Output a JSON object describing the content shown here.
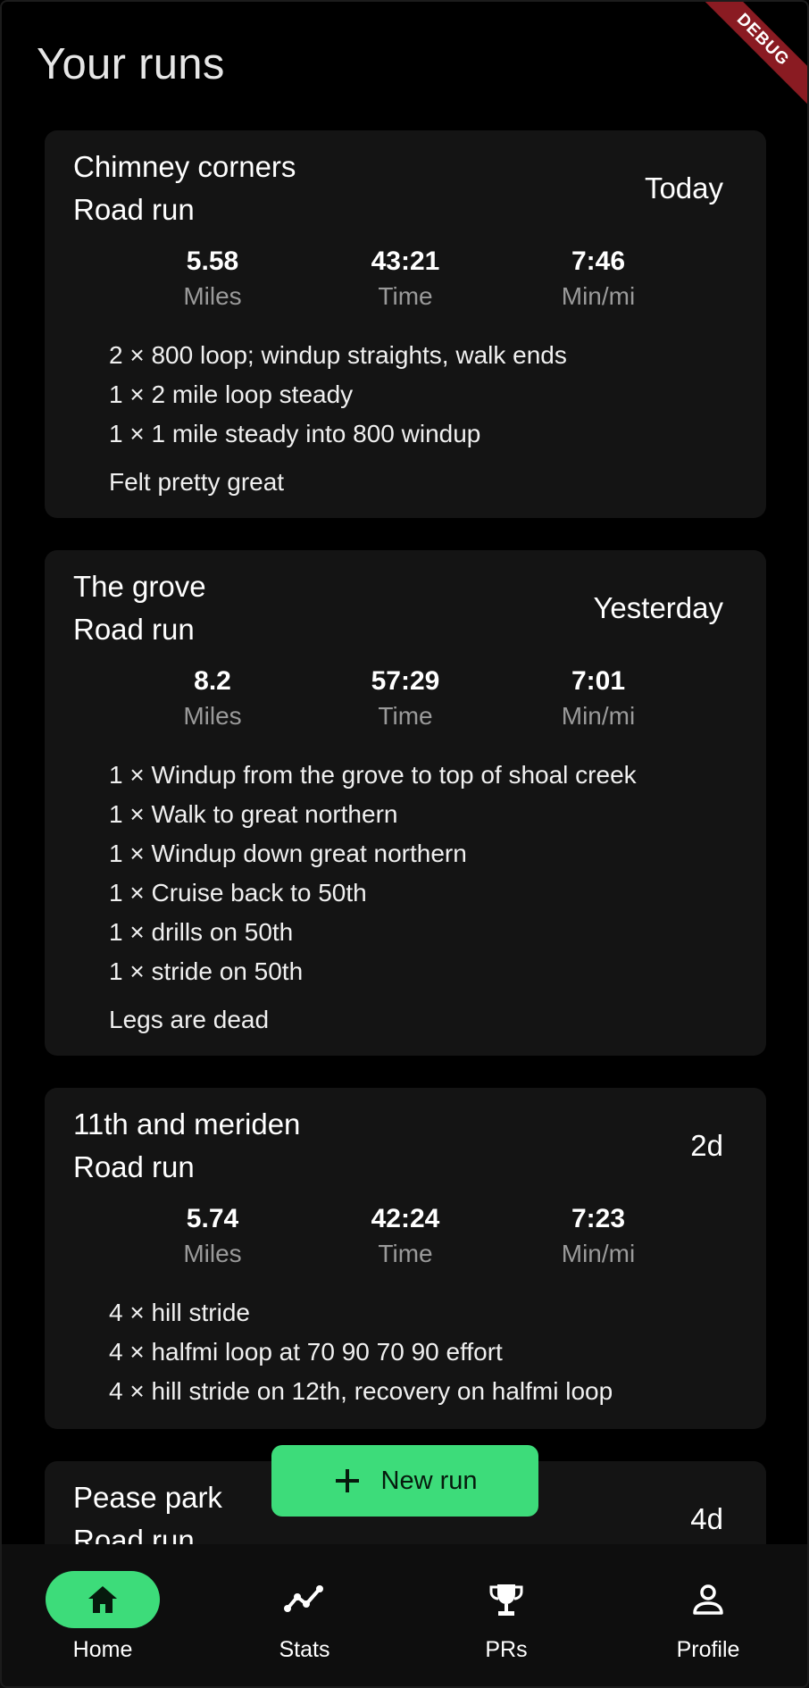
{
  "page": {
    "title": "Your runs",
    "debug_banner": "DEBUG"
  },
  "runs": [
    {
      "name": "Chimney corners",
      "type": "Road run",
      "date": "Today",
      "stats": [
        {
          "value": "5.58",
          "label": "Miles"
        },
        {
          "value": "43:21",
          "label": "Time"
        },
        {
          "value": "7:46",
          "label": "Min/mi"
        }
      ],
      "segments": [
        "2 × 800 loop; windup straights, walk ends",
        "1 × 2 mile loop steady",
        "1 × 1 mile steady into 800 windup"
      ],
      "note": "Felt pretty great"
    },
    {
      "name": "The grove",
      "type": "Road run",
      "date": "Yesterday",
      "stats": [
        {
          "value": "8.2",
          "label": "Miles"
        },
        {
          "value": "57:29",
          "label": "Time"
        },
        {
          "value": "7:01",
          "label": "Min/mi"
        }
      ],
      "segments": [
        "1 × Windup from the grove to top of shoal creek",
        "1 × Walk to great northern",
        "1 × Windup down great northern",
        "1 × Cruise back to 50th",
        "1 × drills on 50th",
        "1 × stride on 50th"
      ],
      "note": "Legs are dead"
    },
    {
      "name": "11th and meriden",
      "type": "Road run",
      "date": "2d",
      "stats": [
        {
          "value": "5.74",
          "label": "Miles"
        },
        {
          "value": "42:24",
          "label": "Time"
        },
        {
          "value": "7:23",
          "label": "Min/mi"
        }
      ],
      "segments": [
        "4 × hill stride",
        "4 × halfmi loop at 70 90 70 90 effort",
        "4 × hill stride on 12th, recovery on halfmi loop"
      ],
      "note": ""
    },
    {
      "name": "Pease park",
      "type": "Road run",
      "date": "4d",
      "stats": [],
      "segments": [],
      "note": ""
    }
  ],
  "fab": {
    "label": "New run",
    "icon": "plus-icon"
  },
  "nav": [
    {
      "label": "Home",
      "icon": "home-icon",
      "active": true
    },
    {
      "label": "Stats",
      "icon": "stats-icon",
      "active": false
    },
    {
      "label": "PRs",
      "icon": "trophy-icon",
      "active": false
    },
    {
      "label": "Profile",
      "icon": "person-icon",
      "active": false
    }
  ],
  "colors": {
    "accent": "#3ddc7a",
    "card": "#141414",
    "background": "#000000",
    "muted_text": "#9a9a9a",
    "debug": "#8a1b22"
  }
}
